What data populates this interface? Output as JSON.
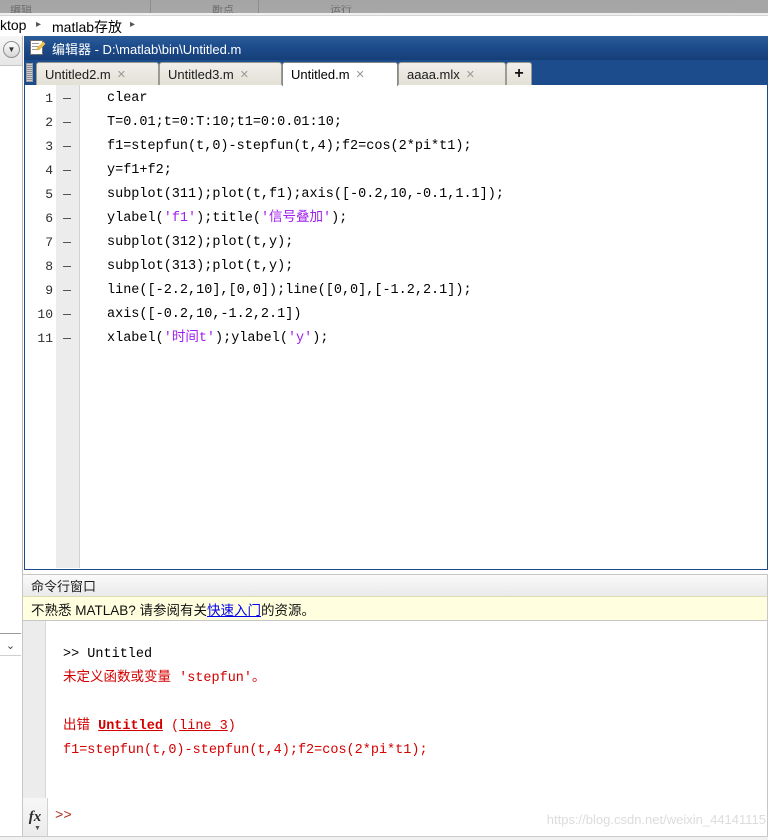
{
  "ribbon": {
    "items": [
      {
        "label": "编辑"
      },
      {
        "label": "断点"
      },
      {
        "label": "运行"
      }
    ]
  },
  "breadcrumb": {
    "path_text": "ktop",
    "folder": "matlab存放",
    "arrow": "▸"
  },
  "left_panel": {
    "dropdown_icon": "▼",
    "collapse_icon": "⌄"
  },
  "editor": {
    "title": "编辑器 - D:\\matlab\\bin\\Untitled.m",
    "title_icon": "editor-document-pencil",
    "tabs": [
      {
        "label": "Untitled2.m",
        "close": "✕",
        "active": false
      },
      {
        "label": "Untitled3.m",
        "close": "✕",
        "active": false
      },
      {
        "label": "Untitled.m",
        "close": "✕",
        "active": true
      },
      {
        "label": "aaaa.mlx",
        "close": "✕",
        "active": false
      }
    ],
    "add_tab_label": "+",
    "lines": [
      {
        "n": "1",
        "mark": "—",
        "code": "clear"
      },
      {
        "n": "2",
        "mark": "—",
        "code": "T=0.01;t=0:T:10;t1=0:0.01:10;"
      },
      {
        "n": "3",
        "mark": "—",
        "code": "f1=stepfun(t,0)-stepfun(t,4);f2=cos(2*pi*t1);"
      },
      {
        "n": "4",
        "mark": "—",
        "code": "y=f1+f2;"
      },
      {
        "n": "5",
        "mark": "—",
        "code": "subplot(311);plot(t,f1);axis([-0.2,10,-0.1,1.1]);"
      },
      {
        "n": "6",
        "mark": "—",
        "code": "ylabel('f1');title('信号叠加');",
        "str_spans": [
          [
            "'f1'"
          ],
          [
            "'信号叠加'"
          ]
        ]
      },
      {
        "n": "7",
        "mark": "—",
        "code": "subplot(312);plot(t,y);"
      },
      {
        "n": "8",
        "mark": "—",
        "code": "subplot(313);plot(t,y);"
      },
      {
        "n": "9",
        "mark": "—",
        "code": "line([-2.2,10],[0,0]);line([0,0],[-1.2,2.1]);"
      },
      {
        "n": "10",
        "mark": "—",
        "code": "axis([-0.2,10,-1.2,2.1])"
      },
      {
        "n": "11",
        "mark": "—",
        "code": "xlabel('时间t');ylabel('y');",
        "str_spans": [
          [
            "'时间t'"
          ],
          [
            "'y'"
          ]
        ]
      }
    ]
  },
  "command_window": {
    "title": "命令行窗口",
    "banner": {
      "before": "不熟悉 MATLAB? 请参阅有关",
      "link": "快速入门",
      "after": "的资源。"
    },
    "output": [
      {
        "text": ">> Untitled",
        "type": "normal"
      },
      {
        "text": "未定义函数或变量 'stepfun'。",
        "type": "error"
      },
      {
        "text": "",
        "type": "blank"
      },
      {
        "text": "出错 Untitled (line 3)",
        "type": "error-link",
        "prefix": "出错 ",
        "bold": "Untitled",
        "mid": " (",
        "link": "line 3",
        "suffix": ")"
      },
      {
        "text": "f1=stepfun(t,0)-stepfun(t,4);f2=cos(2*pi*t1);",
        "type": "error"
      }
    ],
    "prompt": ">>",
    "fx_label": "fx"
  },
  "watermark": "https://blog.csdn.net/weixin_44141115",
  "colors": {
    "title_bar": "#1d4c8c",
    "string_token": "#a020f0",
    "error_text": "#d40000",
    "banner_bg": "#ffffdf",
    "link": "#0000ee"
  }
}
